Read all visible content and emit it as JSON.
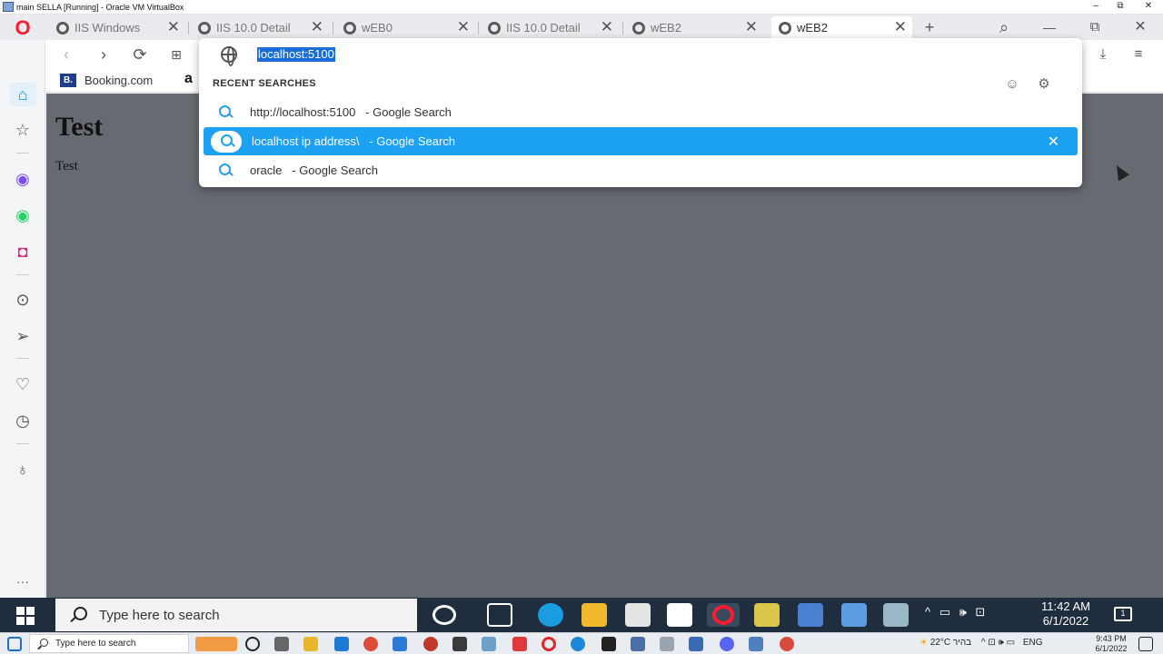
{
  "host_window": {
    "title": "main SELLA [Running] - Oracle VM VirtualBox",
    "minimize": "–",
    "restore": "⧉",
    "close": "✕"
  },
  "browser": {
    "tabs": [
      {
        "title": "IIS Windows",
        "active": false
      },
      {
        "title": "IIS 10.0 Detail",
        "active": false
      },
      {
        "title": "wEB0",
        "active": false
      },
      {
        "title": "IIS 10.0 Detail",
        "active": false
      },
      {
        "title": "wEB2",
        "active": false
      },
      {
        "title": "wEB2",
        "active": true
      }
    ],
    "tab_close": "✕",
    "new_tab": "+",
    "window_controls": {
      "search": "⌕",
      "minimize": "—",
      "restore": "⧉",
      "close": "✕"
    },
    "bookmarks": [
      {
        "label": "Booking.com",
        "icon_text": "B."
      },
      {
        "label": "a"
      }
    ]
  },
  "address_dropdown": {
    "url": "localhost:5100",
    "section_title": "RECENT SEARCHES",
    "rows": [
      {
        "query": "http://localhost:5100",
        "suffix": "   - Google Search",
        "selected": false
      },
      {
        "query": "localhost ip address\\",
        "suffix": "   - Google Search",
        "selected": true
      },
      {
        "query": "oracle",
        "suffix": "   - Google Search",
        "selected": false
      }
    ],
    "row_close": "✕"
  },
  "page": {
    "heading": "Test",
    "text": "Test"
  },
  "sidebar": {
    "more": "···"
  },
  "taskbar": {
    "search_placeholder": "Type here to search",
    "clock_time": "11:42 AM",
    "clock_date": "6/1/2022",
    "tray_text": "^ ▭ 🕪 ⊡"
  },
  "host_taskbar": {
    "search_placeholder": "Type here to search",
    "weather": "22°C",
    "weather_label": "בהיר",
    "lang": "ENG",
    "time": "9:43 PM",
    "date": "6/1/2022"
  },
  "colors": {
    "accent": "#1da1f2",
    "opera_red": "#ff1b2d",
    "page_bg": "#666b72",
    "taskbar": "#1f2d3e"
  }
}
